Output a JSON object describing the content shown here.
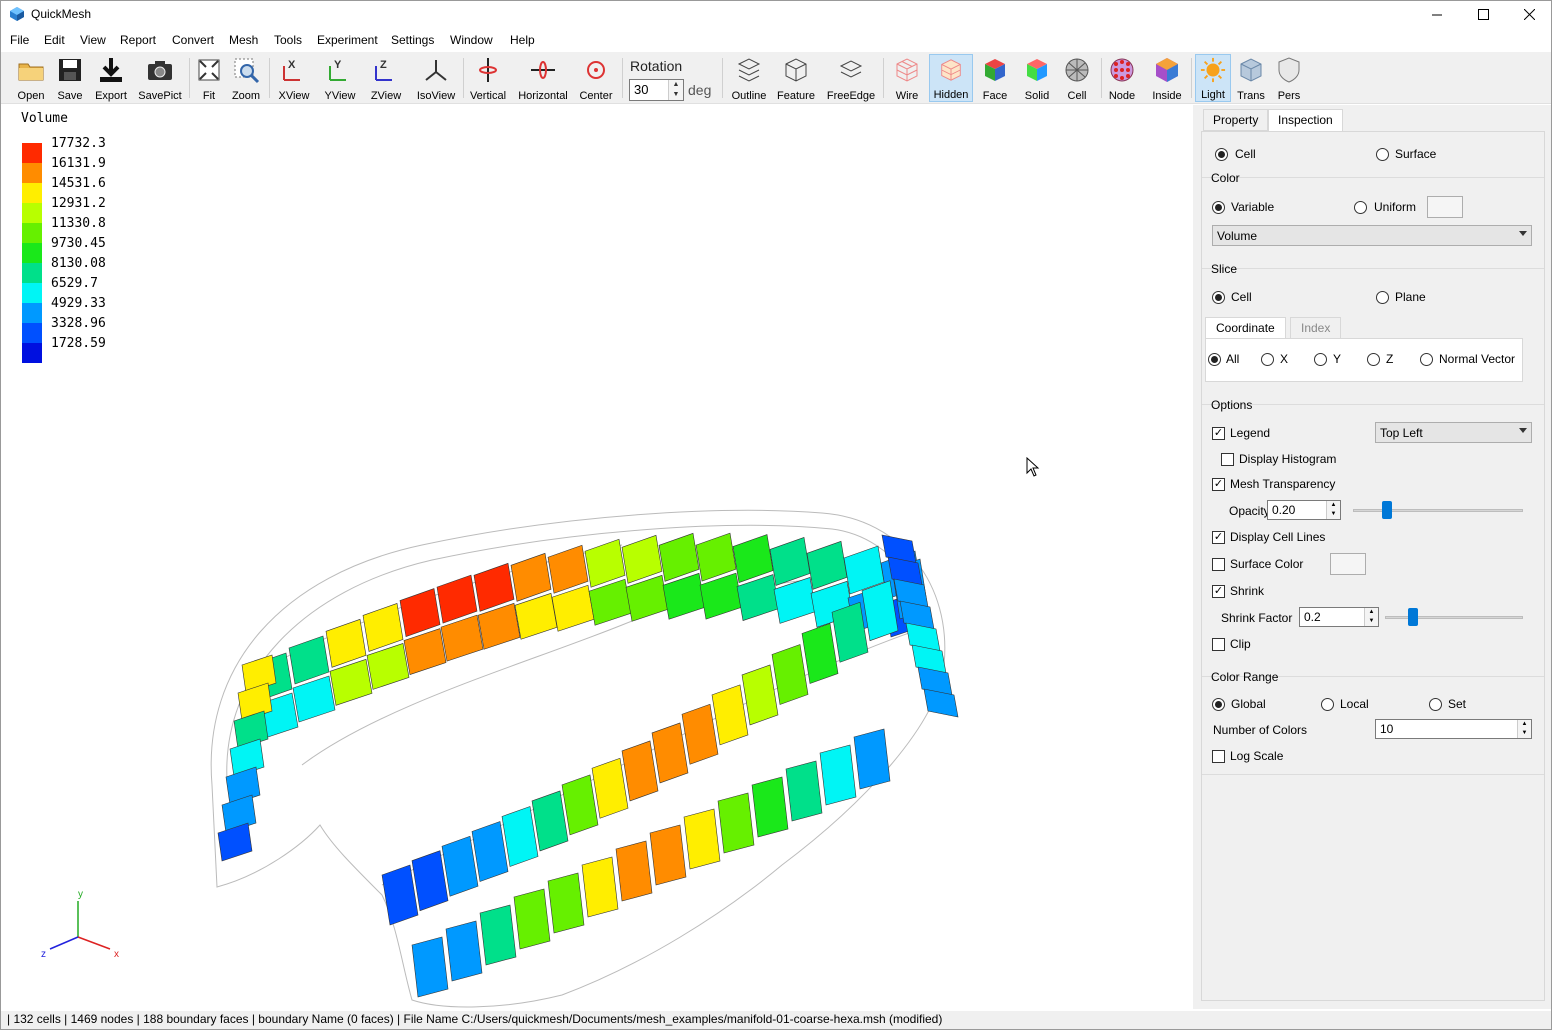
{
  "window": {
    "title": "QuickMesh"
  },
  "menu": [
    "File",
    "Edit",
    "View",
    "Report",
    "Convert",
    "Mesh",
    "Tools",
    "Experiment",
    "Settings",
    "Window",
    "Help"
  ],
  "toolbar": {
    "open": "Open",
    "save": "Save",
    "export": "Export",
    "savepict": "SavePict",
    "fit": "Fit",
    "zoom": "Zoom",
    "xview": "XView",
    "yview": "YView",
    "zview": "ZView",
    "isoview": "IsoView",
    "vertical": "Vertical",
    "horizontal": "Horizontal",
    "center": "Center",
    "rotation_label": "Rotation",
    "rotation_value": "30",
    "rotation_unit": "deg",
    "outline": "Outline",
    "feature": "Feature",
    "freeedge": "FreeEdge",
    "wire": "Wire",
    "hidden": "Hidden",
    "face": "Face",
    "solid": "Solid",
    "cell": "Cell",
    "node": "Node",
    "inside": "Inside",
    "light": "Light",
    "trans": "Trans",
    "pers": "Pers"
  },
  "legend": {
    "title": "Volume",
    "entries": [
      {
        "value": "17732.3",
        "color": "#ff2a00"
      },
      {
        "value": "16131.9",
        "color": "#ff8c00"
      },
      {
        "value": "14531.6",
        "color": "#ffee00"
      },
      {
        "value": "12931.2",
        "color": "#b8ff00"
      },
      {
        "value": "11330.8",
        "color": "#66f000"
      },
      {
        "value": "9730.45",
        "color": "#1ae81a"
      },
      {
        "value": "8130.08",
        "color": "#00e08a"
      },
      {
        "value": "6529.7",
        "color": "#00f5f5"
      },
      {
        "value": "4929.33",
        "color": "#0099ff"
      },
      {
        "value": "3328.96",
        "color": "#0050ff"
      },
      {
        "value": "1728.59",
        "color": "#0010e0"
      }
    ]
  },
  "axes": {
    "y": "y",
    "z": "z",
    "x": "x"
  },
  "panel": {
    "tabs": {
      "property": "Property",
      "inspection": "Inspection"
    },
    "target": {
      "cell": "Cell",
      "surface": "Surface"
    },
    "color": {
      "heading": "Color",
      "variable": "Variable",
      "uniform": "Uniform",
      "variable_selected": "Volume"
    },
    "slice": {
      "heading": "Slice",
      "cell": "Cell",
      "plane": "Plane",
      "subtabs": {
        "coordinate": "Coordinate",
        "index": "Index"
      },
      "axes": {
        "all": "All",
        "x": "X",
        "y": "Y",
        "z": "Z",
        "normal": "Normal Vector"
      }
    },
    "options": {
      "heading": "Options",
      "legend": "Legend",
      "legend_position": "Top Left",
      "histogram": "Display Histogram",
      "mesh_transparency": "Mesh Transparency",
      "opacity_label": "Opacity",
      "opacity_value": "0.20",
      "opacity_level": 0.2,
      "cell_lines": "Display Cell Lines",
      "surface_color": "Surface Color",
      "shrink": "Shrink",
      "shrink_factor_label": "Shrink Factor",
      "shrink_factor_value": "0.2",
      "shrink_level": 0.2,
      "clip": "Clip"
    },
    "color_range": {
      "heading": "Color Range",
      "global": "Global",
      "local": "Local",
      "set": "Set",
      "num_colors_label": "Number of Colors",
      "num_colors_value": "10",
      "log_scale": "Log Scale"
    }
  },
  "status": "| 132 cells | 1469 nodes | 188 boundary faces |  boundary Name  (0 faces) | File Name C:/Users/quickmesh/Documents/mesh_examples/manifold-01-coarse-hexa.msh (modified)"
}
